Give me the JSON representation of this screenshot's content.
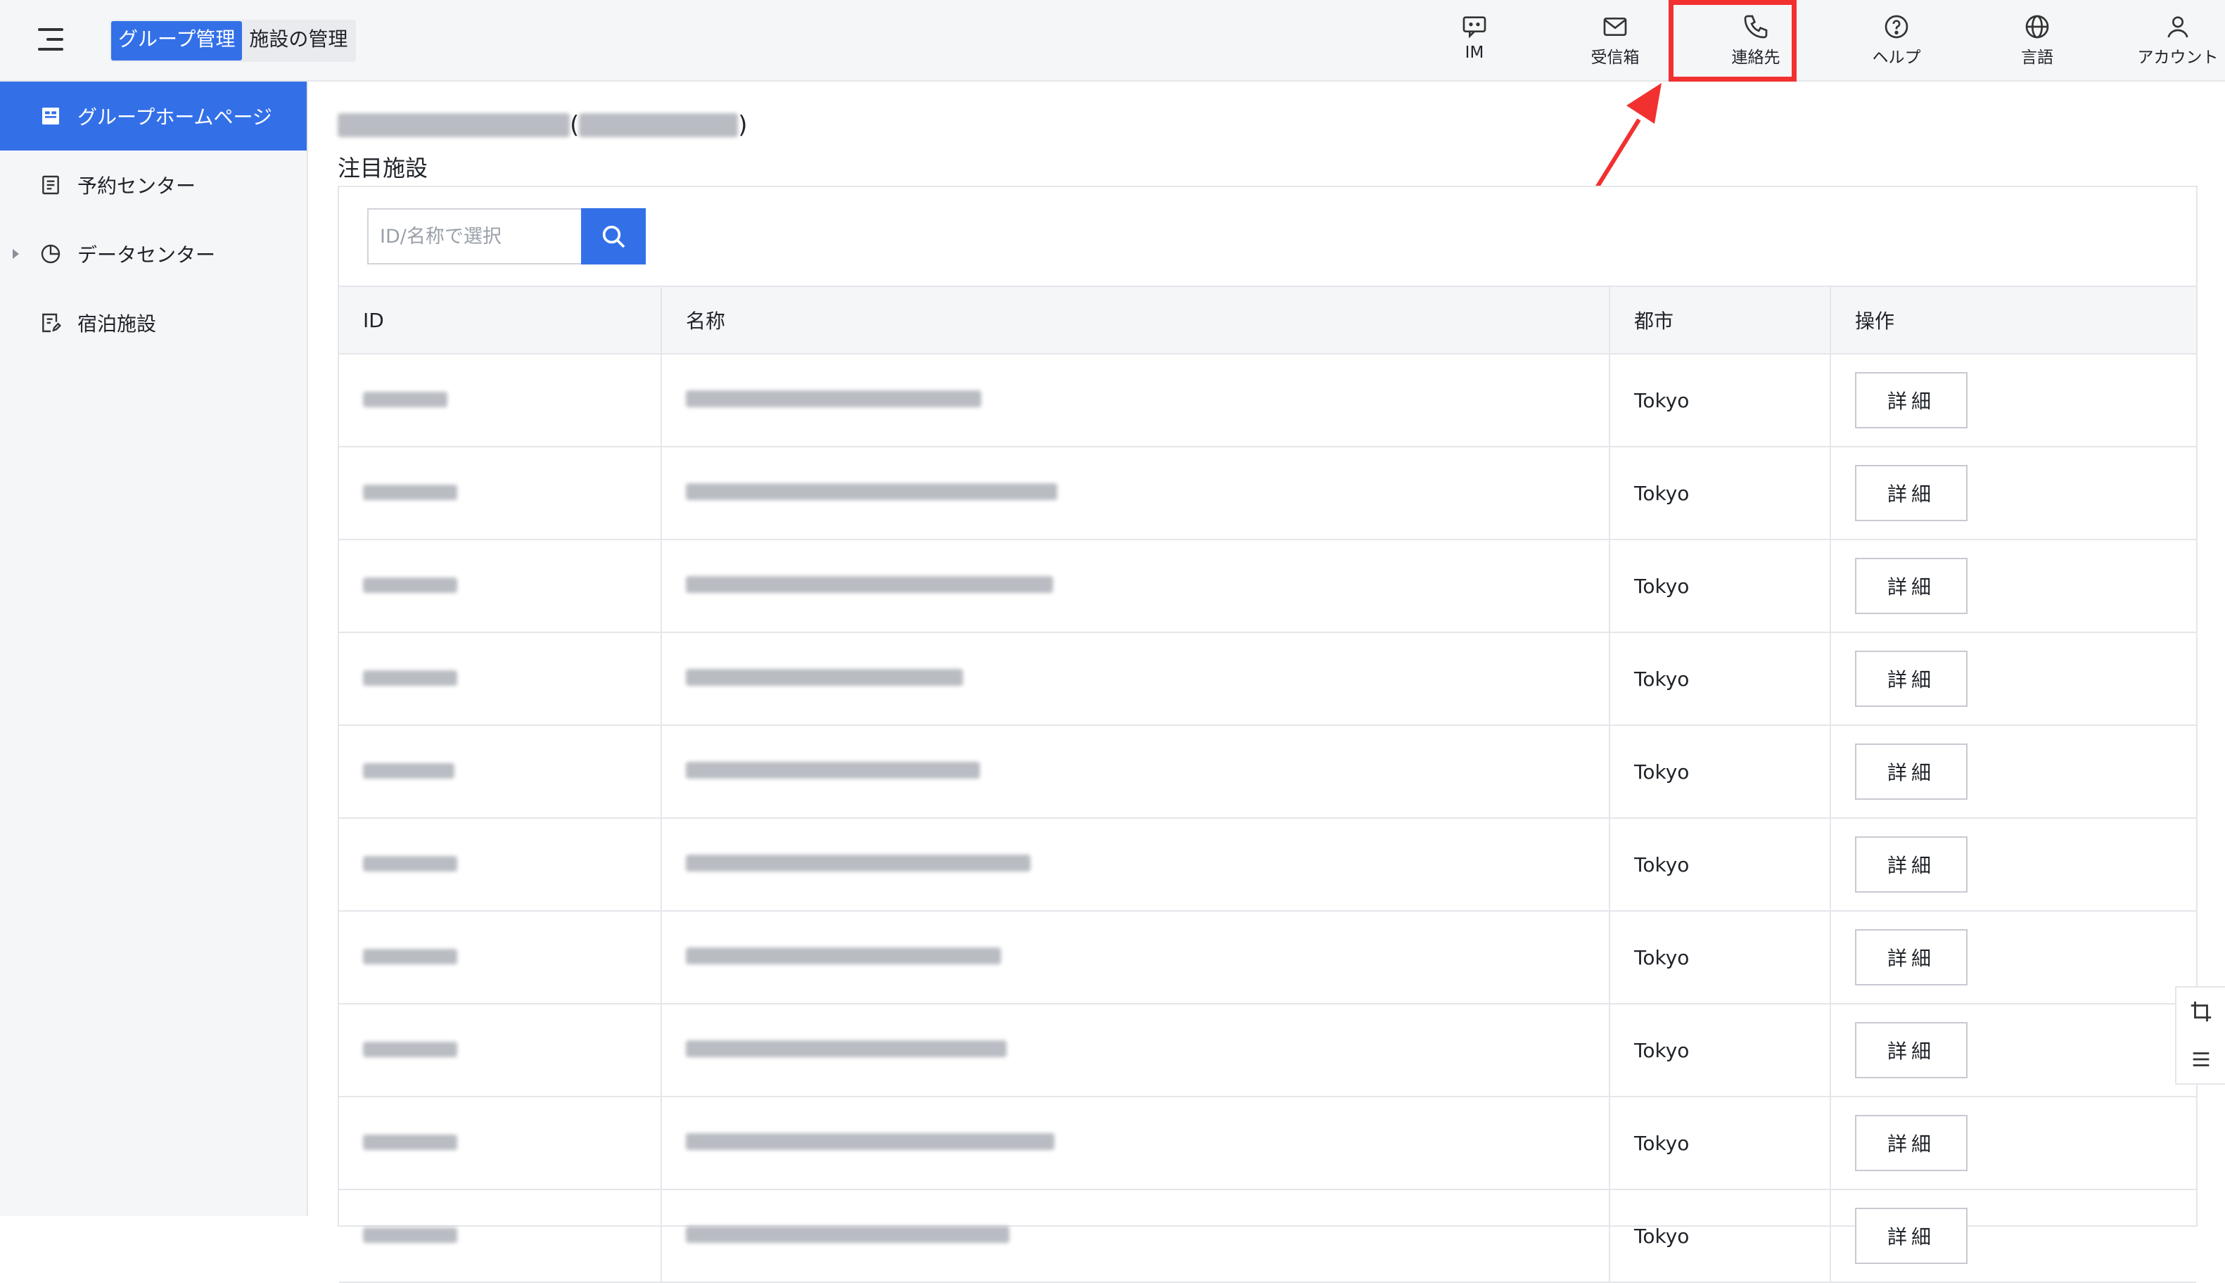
{
  "header": {
    "menu_icon": "hamburger-icon",
    "mode_tabs": [
      {
        "label": "グループ管理",
        "active": true
      },
      {
        "label": "施設の管理",
        "active": false
      }
    ],
    "nav": [
      {
        "label": "IM",
        "icon": "chat-icon"
      },
      {
        "label": "受信箱",
        "icon": "mail-icon"
      },
      {
        "label": "連絡先",
        "icon": "phone-icon",
        "highlighted": true
      },
      {
        "label": "ヘルプ",
        "icon": "help-icon"
      },
      {
        "label": "言語",
        "icon": "globe-icon"
      },
      {
        "label": "アカウント",
        "icon": "user-icon"
      }
    ]
  },
  "sidebar": {
    "items": [
      {
        "label": "グループホームページ",
        "icon": "home-icon",
        "active": true
      },
      {
        "label": "予約センター",
        "icon": "document-icon",
        "active": false
      },
      {
        "label": "データセンター",
        "icon": "pie-chart-icon",
        "active": false,
        "expandable": true
      },
      {
        "label": "宿泊施設",
        "icon": "edit-document-icon",
        "active": false
      }
    ]
  },
  "main": {
    "group_name_suffix_open": "(",
    "group_name_suffix_close": ")",
    "section_title": "注目施設",
    "search": {
      "placeholder": "ID/名称で選択",
      "value": ""
    },
    "table": {
      "columns": [
        "ID",
        "名称",
        "都市",
        "操作"
      ],
      "rows": [
        {
          "id": "",
          "name": "",
          "city": "Tokyo",
          "action": "詳細"
        },
        {
          "id": "",
          "name": "",
          "city": "Tokyo",
          "action": "詳細"
        },
        {
          "id": "",
          "name": "",
          "city": "Tokyo",
          "action": "詳細"
        },
        {
          "id": "",
          "name": "",
          "city": "Tokyo",
          "action": "詳細"
        },
        {
          "id": "",
          "name": "",
          "city": "Tokyo",
          "action": "詳細"
        },
        {
          "id": "",
          "name": "",
          "city": "Tokyo",
          "action": "詳細"
        },
        {
          "id": "",
          "name": "",
          "city": "Tokyo",
          "action": "詳細"
        },
        {
          "id": "",
          "name": "",
          "city": "Tokyo",
          "action": "詳細"
        },
        {
          "id": "",
          "name": "",
          "city": "Tokyo",
          "action": "詳細"
        },
        {
          "id": "",
          "name": "",
          "city": "Tokyo",
          "action": "詳細"
        }
      ]
    }
  },
  "float_tools": [
    {
      "icon": "crop-icon"
    },
    {
      "icon": "list-icon"
    }
  ],
  "colors": {
    "accent": "#3370e8",
    "highlight": "#f23030",
    "background": "#f5f6f8"
  }
}
